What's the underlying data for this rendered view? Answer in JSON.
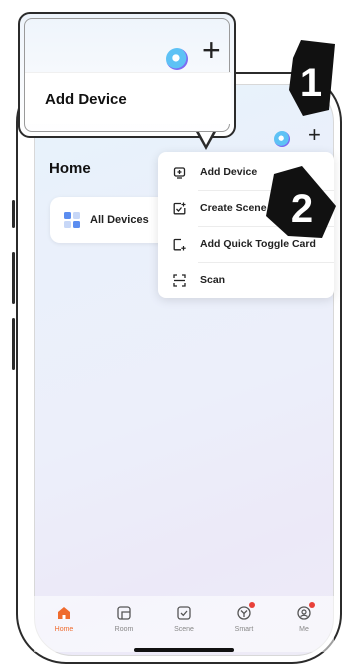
{
  "callout": {
    "title": "Add Device"
  },
  "home": {
    "title": "Home",
    "all_devices": "All Devices"
  },
  "menu": {
    "items": [
      {
        "label": "Add Device",
        "icon": "add-device-icon"
      },
      {
        "label": "Create Scene",
        "icon": "create-scene-icon"
      },
      {
        "label": "Add Quick Toggle Card",
        "icon": "quick-toggle-icon"
      },
      {
        "label": "Scan",
        "icon": "scan-icon"
      }
    ]
  },
  "steps": {
    "one": "1",
    "two": "2"
  },
  "tabs": [
    {
      "label": "Home",
      "icon": "home-icon",
      "active": true
    },
    {
      "label": "Room",
      "icon": "room-icon"
    },
    {
      "label": "Scene",
      "icon": "scene-icon"
    },
    {
      "label": "Smart",
      "icon": "smart-icon",
      "badge": true
    },
    {
      "label": "Me",
      "icon": "me-icon",
      "badge": true
    }
  ],
  "colors": {
    "accent": "#ef6b2e",
    "badge": "#e8403a",
    "tile_blue": "#5b8df0",
    "tile_light": "#c7d7f7"
  }
}
